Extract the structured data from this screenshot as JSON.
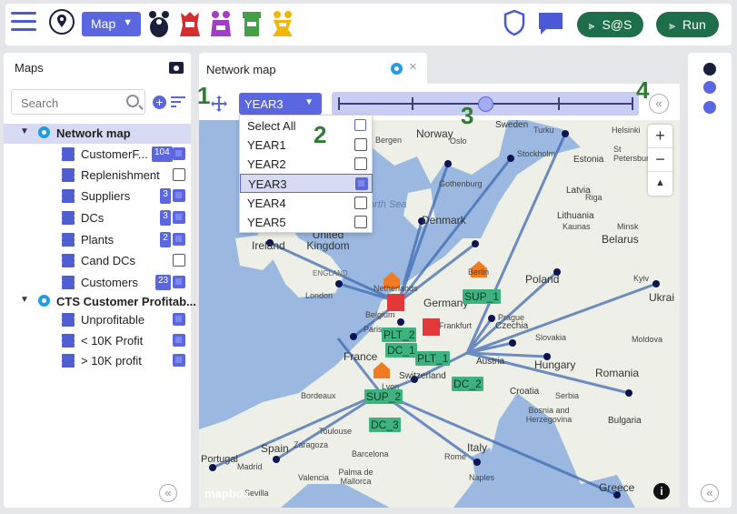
{
  "topbar": {
    "map_button": "Map",
    "sas_button": "S@S",
    "run_button": "Run"
  },
  "left_panel": {
    "title": "Maps",
    "search_placeholder": "Search",
    "groups": [
      {
        "label": "Network map",
        "layers": [
          {
            "label": "CustomerF...",
            "badge": "104",
            "checked": true
          },
          {
            "label": "Replenishment ...",
            "badge": "",
            "checked": false
          },
          {
            "label": "Suppliers",
            "badge": "3",
            "checked": true
          },
          {
            "label": "DCs",
            "badge": "3",
            "checked": true
          },
          {
            "label": "Plants",
            "badge": "2",
            "checked": true
          },
          {
            "label": "Cand DCs",
            "badge": "",
            "checked": false
          },
          {
            "label": "Customers",
            "badge": "23",
            "checked": true
          }
        ]
      },
      {
        "label": "CTS Customer Profitab...",
        "layers": [
          {
            "label": "Unprofitable",
            "badge": "",
            "checked": true
          },
          {
            "label": "< 10K Profit",
            "badge": "",
            "checked": true
          },
          {
            "label": "> 10K profit",
            "badge": "",
            "checked": true
          }
        ]
      }
    ],
    "collapse": "«"
  },
  "tab": {
    "label": "Network map",
    "close": "×"
  },
  "controls": {
    "year_selected": "YEAR3",
    "callouts": [
      "1",
      "2",
      "3",
      "4"
    ],
    "collapse": "«"
  },
  "dropdown": {
    "select_all": "Select All",
    "options": [
      {
        "label": "YEAR1",
        "checked": false
      },
      {
        "label": "YEAR2",
        "checked": false
      },
      {
        "label": "YEAR3",
        "checked": true
      },
      {
        "label": "YEAR4",
        "checked": false
      },
      {
        "label": "YEAR5",
        "checked": false
      }
    ]
  },
  "map": {
    "zoom_in": "+",
    "zoom_out": "−",
    "compass": "▲",
    "attribution": "mapbox",
    "info": "i",
    "places_large": [
      "Norway",
      "Denmark",
      "United Kingdom",
      "Ireland",
      "Germany",
      "Poland",
      "Belarus",
      "France",
      "Hungary",
      "Romania",
      "Austria",
      "Italy",
      "Spain",
      "Portugal",
      "Greece",
      "Ukrai",
      "Estonia",
      "Latvia",
      "Lithuania",
      "Sweden"
    ],
    "places_small": [
      "Bergen",
      "Oslo",
      "Stockholm",
      "Turku",
      "Helsinki",
      "St Petersburg",
      "Gothenburg",
      "Riga",
      "Kaunas",
      "Minsk",
      "London",
      "Berlin",
      "Prague",
      "Czechia",
      "Slovakia",
      "Moldova",
      "Bordeaux",
      "Toulouse",
      "Lyon",
      "Switzerland",
      "Croatia",
      "Serbia",
      "Bulgaria",
      "Bosnia and Herzegovina",
      "Zaragoza",
      "Barcelona",
      "Madrid",
      "Valencia",
      "Sevilla",
      "Palma de Mallorca",
      "Naples",
      "Rome",
      "Kyiv",
      "Netherlands",
      "Belgium",
      "Frankfurt",
      "Paris",
      "ENGLAND"
    ],
    "sea_label": "North Sea",
    "site_labels": [
      "SUP_1",
      "PLT_2",
      "DC_1",
      "PLT_1",
      "DC_2",
      "SUP_2",
      "DC_3"
    ],
    "colors": {
      "land": "#eef0e8",
      "sea": "#9ab8e0",
      "flow": "#3e6bb5",
      "customer": "#0d1450",
      "site": "#3fb37f",
      "plant": "#e23a3a",
      "supplier": "#f07b22"
    }
  },
  "accent": "#5b67e0",
  "green": "#1e6e4a"
}
